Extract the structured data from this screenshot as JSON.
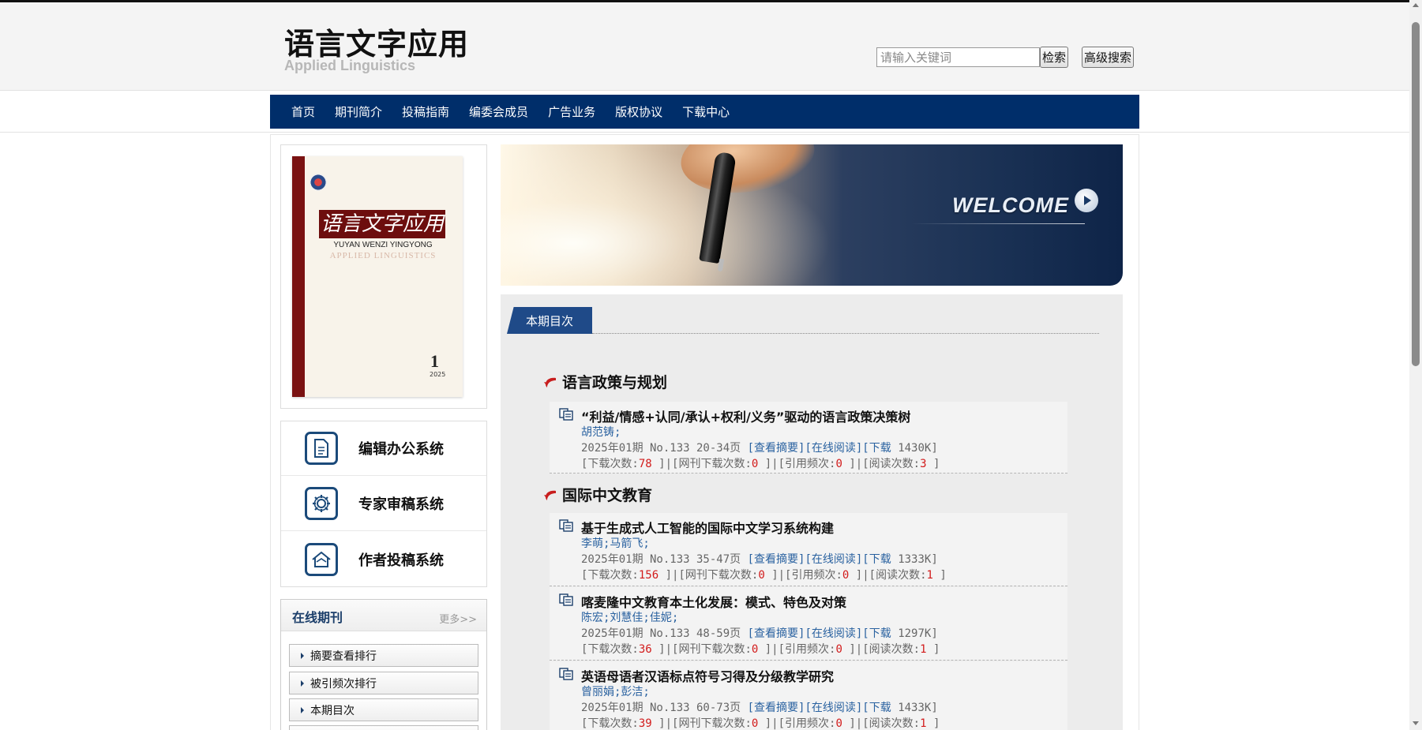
{
  "header": {
    "title": "语言文字应用",
    "subtitle": "Applied Linguistics",
    "search_placeholder": "请输入关键词",
    "search_button": "检索",
    "advanced_button": "高级搜索"
  },
  "nav": [
    "首页",
    "期刊简介",
    "投稿指南",
    "编委会成员",
    "广告业务",
    "版权协议",
    "下载中心"
  ],
  "cover": {
    "title": "语言文字应用",
    "pinyin": "YUYAN WENZI YINGYONG",
    "english": "APPLIED LINGUISTICS",
    "issue": "1",
    "year": "2025"
  },
  "systems": [
    {
      "label": "编辑办公系统",
      "icon": "document-icon"
    },
    {
      "label": "专家审稿系统",
      "icon": "gear-icon"
    },
    {
      "label": "作者投稿系统",
      "icon": "house-icon"
    }
  ],
  "online": {
    "title": "在线期刊",
    "more": "更多>>",
    "items": [
      "摘要查看排行",
      "被引频次排行",
      "本期目次"
    ]
  },
  "banner": {
    "text": "WELCOME"
  },
  "toc": {
    "tab": "本期目次",
    "sections": [
      {
        "title": "语言政策与规划"
      },
      {
        "title": "国际中文教育"
      }
    ],
    "articles": [
      {
        "title": "“利益/情感+认同/承认+权利/义务”驱动的语言政策决策树",
        "authors": "胡范铸;",
        "meta_prefix": "2025年01期 No.133 20-34页",
        "links": "[查看摘要][在线阅读][下载",
        "size": "1430K]",
        "s1": "[下载次数:",
        "v1": "78",
        "s2": "]|[网刊下载次数:",
        "v2": "0",
        "s3": "]|[引用频次:",
        "v3": "0",
        "s4": "]|[阅读次数:",
        "v4": "3",
        "s5": "]"
      },
      {
        "title": "基于生成式人工智能的国际中文学习系统构建",
        "authors": "李萌;马箭飞;",
        "meta_prefix": "2025年01期 No.133 35-47页",
        "links": "[查看摘要][在线阅读][下载",
        "size": "1333K]",
        "s1": "[下载次数:",
        "v1": "156",
        "s2": "]|[网刊下载次数:",
        "v2": "0",
        "s3": "]|[引用频次:",
        "v3": "0",
        "s4": "]|[阅读次数:",
        "v4": "1",
        "s5": "]"
      },
      {
        "title": "喀麦隆中文教育本土化发展：模式、特色及对策",
        "authors": "陈宏;刘慧佳;佳妮;",
        "meta_prefix": "2025年01期 No.133 48-59页",
        "links": "[查看摘要][在线阅读][下载",
        "size": "1297K]",
        "s1": "[下载次数:",
        "v1": "36",
        "s2": "]|[网刊下载次数:",
        "v2": "0",
        "s3": "]|[引用频次:",
        "v3": "0",
        "s4": "]|[阅读次数:",
        "v4": "1",
        "s5": "]"
      },
      {
        "title": "英语母语者汉语标点符号习得及分级教学研究",
        "authors": "曾丽娟;彭洁;",
        "meta_prefix": "2025年01期 No.133 60-73页",
        "links": "[查看摘要][在线阅读][下载",
        "size": "1433K]",
        "s1": "[下载次数:",
        "v1": "39",
        "s2": "]|[网刊下载次数:",
        "v2": "0",
        "s3": "]|[引用频次:",
        "v3": "0",
        "s4": "]|[阅读次数:",
        "v4": "1",
        "s5": "]"
      }
    ]
  }
}
